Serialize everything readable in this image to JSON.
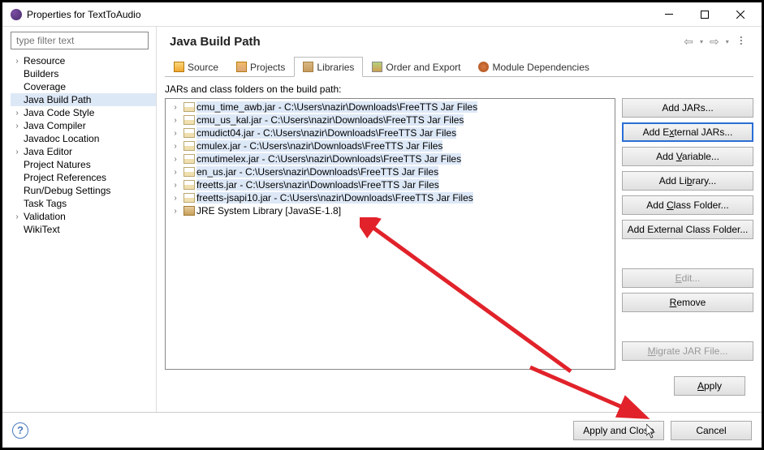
{
  "window": {
    "title": "Properties for TextToAudio"
  },
  "sidebar": {
    "filter_placeholder": "type filter text",
    "items": [
      {
        "label": "Resource",
        "expandable": true
      },
      {
        "label": "Builders",
        "expandable": false
      },
      {
        "label": "Coverage",
        "expandable": false
      },
      {
        "label": "Java Build Path",
        "expandable": false,
        "selected": true
      },
      {
        "label": "Java Code Style",
        "expandable": true
      },
      {
        "label": "Java Compiler",
        "expandable": true
      },
      {
        "label": "Javadoc Location",
        "expandable": false
      },
      {
        "label": "Java Editor",
        "expandable": true
      },
      {
        "label": "Project Natures",
        "expandable": false
      },
      {
        "label": "Project References",
        "expandable": false
      },
      {
        "label": "Run/Debug Settings",
        "expandable": false
      },
      {
        "label": "Task Tags",
        "expandable": false
      },
      {
        "label": "Validation",
        "expandable": true
      },
      {
        "label": "WikiText",
        "expandable": false
      }
    ]
  },
  "content": {
    "title": "Java Build Path",
    "tabs": [
      {
        "icon": "source",
        "label": "Source"
      },
      {
        "icon": "projects",
        "label": "Projects"
      },
      {
        "icon": "libraries",
        "label": "Libraries",
        "active": true
      },
      {
        "icon": "order",
        "label": "Order and Export"
      },
      {
        "icon": "module",
        "label": "Module Dependencies"
      }
    ],
    "jar_label": "JARs and class folders on the build path:",
    "jars": [
      {
        "text": "cmu_time_awb.jar - C:\\Users\\nazir\\Downloads\\FreeTTS Jar Files",
        "selected": true
      },
      {
        "text": "cmu_us_kal.jar - C:\\Users\\nazir\\Downloads\\FreeTTS Jar Files",
        "selected": true
      },
      {
        "text": "cmudict04.jar - C:\\Users\\nazir\\Downloads\\FreeTTS Jar Files",
        "selected": true
      },
      {
        "text": "cmulex.jar - C:\\Users\\nazir\\Downloads\\FreeTTS Jar Files",
        "selected": true
      },
      {
        "text": "cmutimelex.jar - C:\\Users\\nazir\\Downloads\\FreeTTS Jar Files",
        "selected": true
      },
      {
        "text": "en_us.jar - C:\\Users\\nazir\\Downloads\\FreeTTS Jar Files",
        "selected": true
      },
      {
        "text": "freetts.jar - C:\\Users\\nazir\\Downloads\\FreeTTS Jar Files",
        "selected": true
      },
      {
        "text": "freetts-jsapi10.jar - C:\\Users\\nazir\\Downloads\\FreeTTS Jar Files",
        "selected": true
      },
      {
        "text": "JRE System Library [JavaSE-1.8]",
        "selected": false,
        "jre": true
      }
    ],
    "buttons": {
      "add_jars": "Add JARs...",
      "add_external_jars": "Add External JARs...",
      "add_variable": "Add Variable...",
      "add_library": "Add Library...",
      "add_class_folder": "Add Class Folder...",
      "add_external_class_folder": "Add External Class Folder...",
      "edit": "Edit...",
      "remove": "Remove",
      "migrate": "Migrate JAR File...",
      "apply": "Apply"
    }
  },
  "footer": {
    "apply_close": "Apply and Close",
    "cancel": "Cancel"
  }
}
